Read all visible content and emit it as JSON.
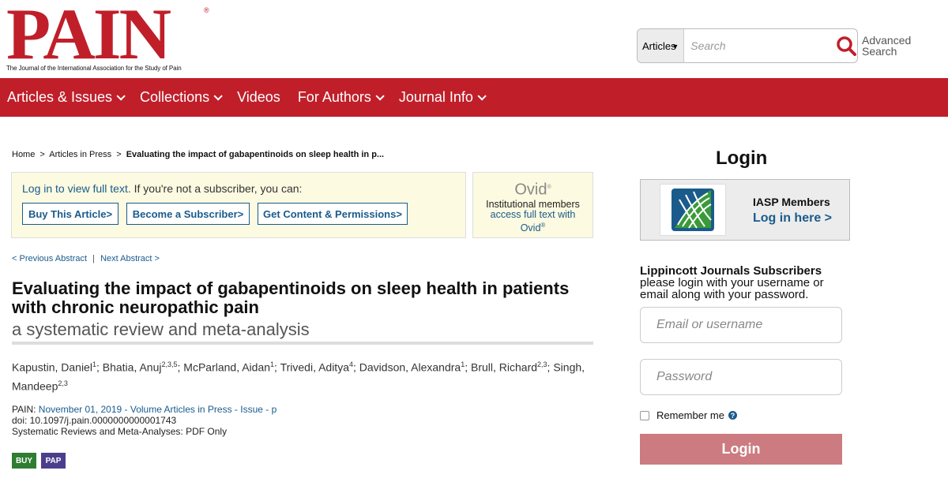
{
  "header": {
    "logo_text": "PAIN",
    "logo_reg": "®",
    "logo_tagline": "The Journal of the International Association for the Study of Pain",
    "search": {
      "type": "Articles",
      "placeholder": "Search",
      "advanced": "Advanced Search"
    }
  },
  "nav": {
    "items": [
      {
        "label": "Articles & Issues",
        "dropdown": true
      },
      {
        "label": "Collections",
        "dropdown": true
      },
      {
        "label": "Videos",
        "dropdown": false
      },
      {
        "label": "For Authors",
        "dropdown": true
      },
      {
        "label": "Journal Info",
        "dropdown": true
      }
    ]
  },
  "breadcrumb": {
    "home": "Home",
    "section": "Articles in Press",
    "current": "Evaluating the impact of gabapentinoids on sleep health in p...",
    "sep": ">"
  },
  "access": {
    "login_link": "Log in to view full text.",
    "rest": " If you're not a subscriber, you can:",
    "buttons": [
      "Buy This Article",
      "Become a Subscriber",
      "Get Content & Permissions"
    ]
  },
  "ovid": {
    "logo": "Ovid",
    "reg": "®",
    "line1": "Institutional members",
    "line2": "access full text with",
    "line3": "Ovid"
  },
  "abstract_nav": {
    "prev": "< Previous Abstract",
    "sep": "|",
    "next": "Next Abstract >"
  },
  "article": {
    "title": "Evaluating the impact of gabapentinoids on sleep health in patients with chronic neuropathic pain",
    "subtitle": "a systematic review and meta-analysis",
    "authors": [
      {
        "name": "Kapustin, Daniel",
        "aff": "1"
      },
      {
        "name": "Bhatia, Anuj",
        "aff": "2,3,5"
      },
      {
        "name": "McParland, Aidan",
        "aff": "1"
      },
      {
        "name": "Trivedi, Aditya",
        "aff": "4"
      },
      {
        "name": "Davidson, Alexandra",
        "aff": "1"
      },
      {
        "name": "Brull, Richard",
        "aff": "2,3"
      },
      {
        "name": "Singh, Mandeep",
        "aff": "2,3"
      }
    ],
    "journal_label": "PAIN:",
    "issue": "November 01, 2019 - Volume Articles in Press - Issue - p",
    "doi": "doi: 10.1097/j.pain.0000000000001743",
    "type": "Systematic Reviews and Meta-Analyses: PDF Only",
    "badges": [
      "BUY",
      "PAP"
    ]
  },
  "login": {
    "title": "Login",
    "iasp_title": "IASP Members",
    "iasp_link": "Log in here >",
    "lip_title": "Lippincott Journals Subscribers",
    "lip_text": "please login with your username or email along with your password.",
    "email_placeholder": "Email or username",
    "password_placeholder": "Password",
    "remember": "Remember me",
    "help": "?",
    "button": "Login"
  },
  "colors": {
    "brand_red": "#c01f2a",
    "link_blue": "#1a5b8c",
    "access_bg": "#fcfae0",
    "buy_badge": "#2e7d32",
    "pap_badge": "#4b3f8c",
    "login_button": "#cc7b80"
  }
}
